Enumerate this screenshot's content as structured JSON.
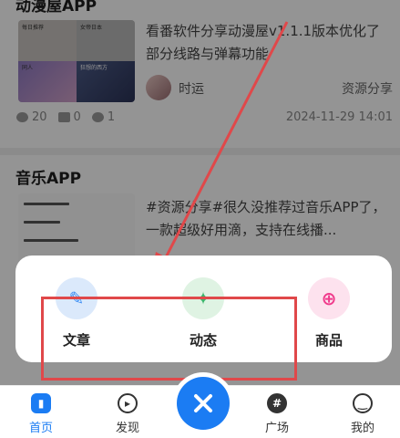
{
  "post1": {
    "title": "动漫屋APP",
    "thumb_captions": [
      "每日推荐",
      "同人",
      "女帝日本",
      "狂想的西方"
    ],
    "summary": "看番软件分享动漫屋v1.1.1版本优化了部分线路与弹幕功能",
    "author": "时运",
    "category": "资源分享",
    "views": "20",
    "likes": "0",
    "comments": "1",
    "date": "2024-11-29 14:01"
  },
  "post2": {
    "title": "音乐APP",
    "summary": "#资源分享#很久没推荐过音乐APP了，一款超级好用滴，支持在线播..."
  },
  "popup": {
    "items": [
      {
        "label": "文章",
        "icon": "pencil-icon",
        "color": "#3f8ef3",
        "bg": "#dbe9fb"
      },
      {
        "label": "动态",
        "icon": "lightbulb-icon",
        "color": "#3db56b",
        "bg": "#dff3e3"
      },
      {
        "label": "商品",
        "icon": "cart-icon",
        "color": "#f03b8c",
        "bg": "#fde2ee"
      }
    ]
  },
  "tabbar": {
    "items": [
      {
        "label": "首页",
        "icon": "home-icon",
        "active": true
      },
      {
        "label": "发现",
        "icon": "play-circle-icon",
        "active": false
      },
      {
        "label": "广场",
        "icon": "hashtag-icon",
        "active": false
      },
      {
        "label": "我的",
        "icon": "smile-icon",
        "active": false
      }
    ],
    "close_icon": "close-icon"
  },
  "colors": {
    "accent": "#1b7cf3",
    "annotation": "#e0484a"
  }
}
